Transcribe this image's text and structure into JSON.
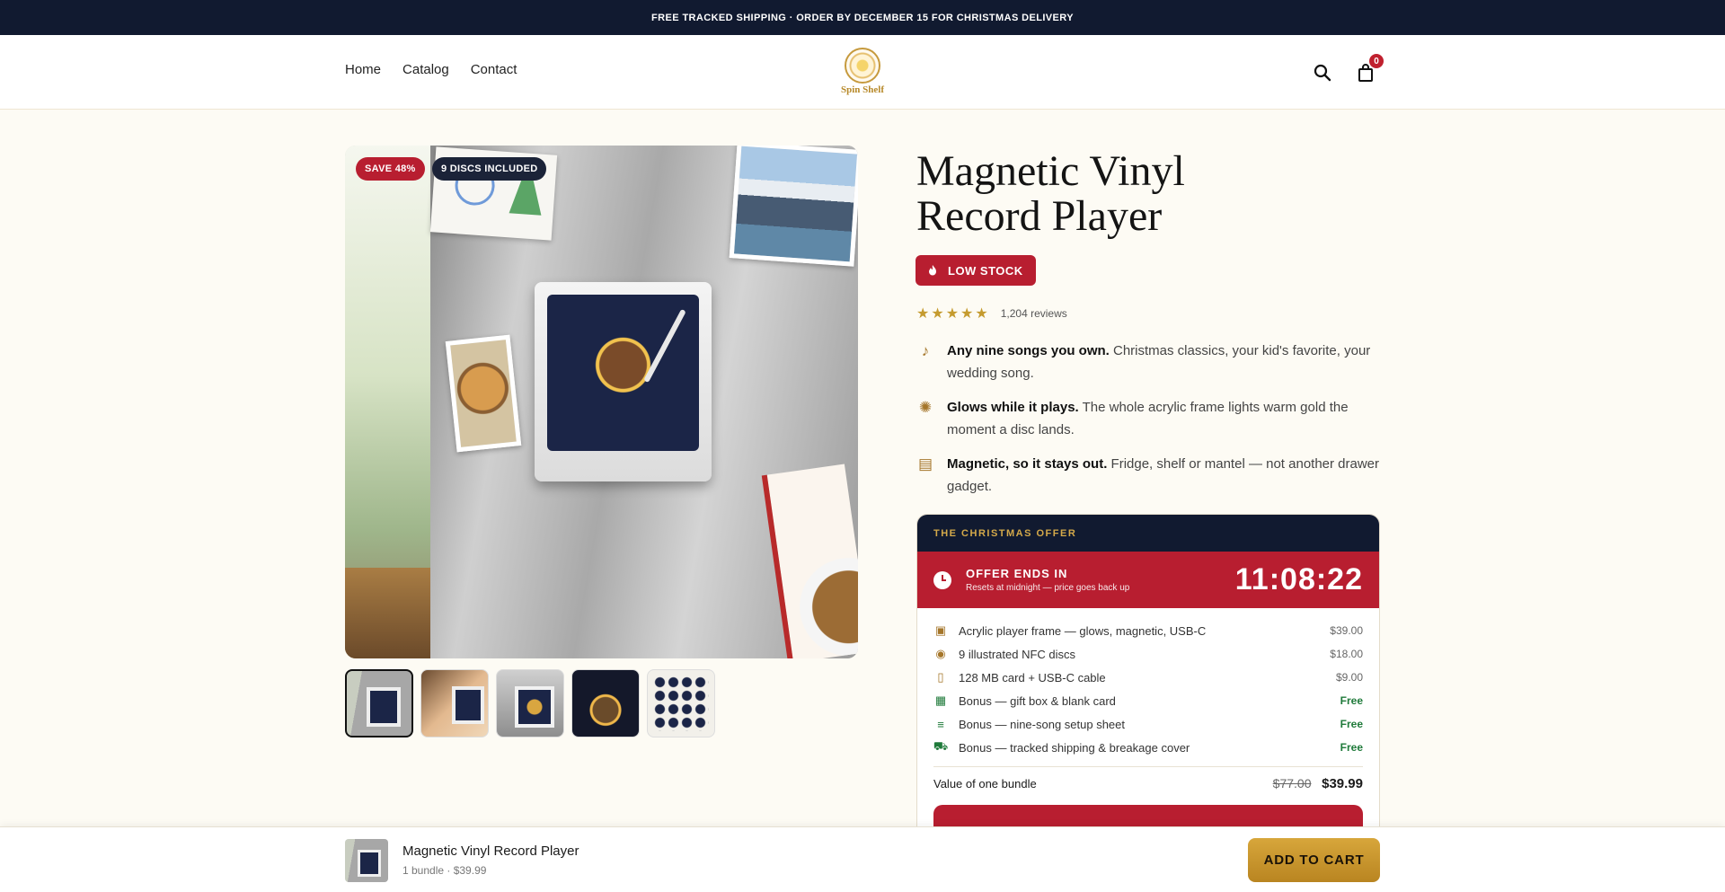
{
  "announcement": "FREE TRACKED SHIPPING · ORDER BY DECEMBER 15 FOR CHRISTMAS DELIVERY",
  "nav": {
    "home": "Home",
    "catalog": "Catalog",
    "contact": "Contact"
  },
  "brand": {
    "name": "Spin Shelf"
  },
  "header": {
    "search_icon": "search-icon",
    "cart_icon": "shopping-bag-icon",
    "cart_count": "0"
  },
  "gallery": {
    "badge_save": "SAVE 48%",
    "badge_discs": "9 DISCS INCLUDED",
    "thumbnail_count": 5,
    "active_thumbnail": 1
  },
  "product": {
    "title_line1": "Magnetic Vinyl",
    "title_line2": "Record Player",
    "stock_label": "LOW STOCK",
    "stock_icon": "flame-icon",
    "stars": "★★★★★",
    "review_count": "1,204 reviews",
    "features": [
      {
        "icon": "music-note-icon",
        "bold": "Any nine songs you own.",
        "text": " Christmas classics, your kid's favorite, your wedding song."
      },
      {
        "icon": "lightbulb-icon",
        "bold": "Glows while it plays.",
        "text": " The whole acrylic frame lights warm gold the moment a disc lands."
      },
      {
        "icon": "fridge-icon",
        "bold": "Magnetic, so it stays out.",
        "text": " Fridge, shelf or mantel — not another drawer gadget."
      }
    ]
  },
  "offer": {
    "header": "THE CHRISTMAS OFFER",
    "timer_title": "OFFER ENDS IN",
    "timer_sub": "Resets at midnight — price goes back up",
    "timer_value": "11:08:22",
    "items": [
      {
        "icon": "frame-icon",
        "label": "Acrylic player frame — glows, magnetic, USB-C",
        "price": "$39.00"
      },
      {
        "icon": "disc-icon",
        "label": "9 illustrated NFC discs",
        "price": "$18.00"
      },
      {
        "icon": "sd-card-icon",
        "label": "128 MB card + USB-C cable",
        "price": "$9.00"
      },
      {
        "icon": "gift-icon",
        "label": "Bonus — gift box & blank card",
        "price": "Free"
      },
      {
        "icon": "playlist-icon",
        "label": "Bonus — nine-song setup sheet",
        "price": "Free"
      },
      {
        "icon": "truck-icon",
        "label": "Bonus — tracked shipping & breakage cover",
        "price": "Free"
      }
    ],
    "value_label": "Value of one bundle",
    "old_price": "$77.00",
    "new_price": "$39.99"
  },
  "sticky": {
    "name": "Magnetic Vinyl Record Player",
    "meta": "1 bundle · $39.99",
    "button": "ADD TO CART"
  },
  "colors": {
    "navy": "#111a30",
    "red": "#b81e30",
    "gold": "#c59b2f",
    "green": "#1f7a3a",
    "cream": "#fdfbf4"
  }
}
